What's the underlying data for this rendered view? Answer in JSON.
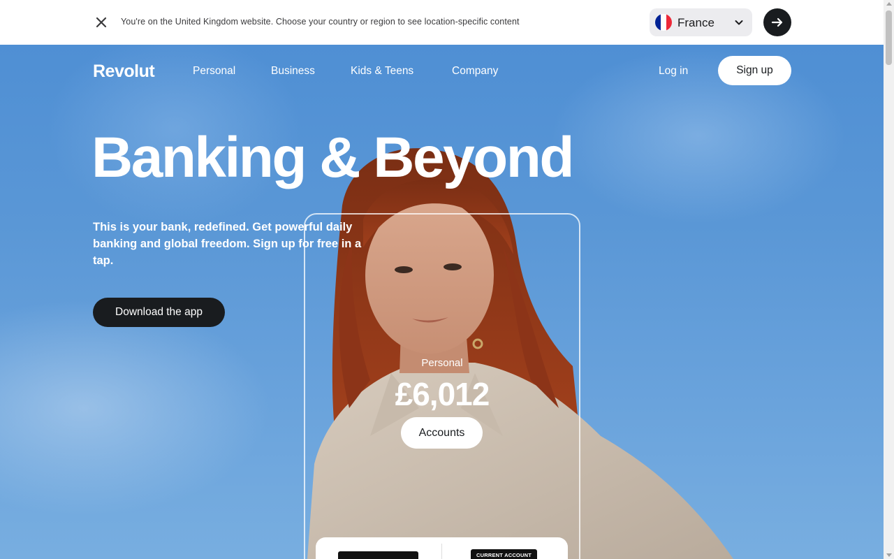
{
  "banner": {
    "message": "You're on the United Kingdom website. Choose your country or region to see location-specific content",
    "country": "France"
  },
  "nav": {
    "logo": "Revolut",
    "items": [
      "Personal",
      "Business",
      "Kids & Teens",
      "Company"
    ],
    "login": "Log in",
    "signup": "Sign up"
  },
  "hero": {
    "headline": "Banking & Beyond",
    "subtext": "This is your bank, redefined. Get powerful daily banking and global freedom. Sign up for free in a tap.",
    "cta": "Download the app"
  },
  "account_card": {
    "label": "Personal",
    "balance": "£6,012",
    "button": "Accounts",
    "card_tag": "CURRENT ACCOUNT"
  },
  "colors": {
    "sky": "#5a97d6",
    "dark": "#191c1f",
    "flag_blue": "#002395",
    "flag_red": "#ED2939"
  }
}
